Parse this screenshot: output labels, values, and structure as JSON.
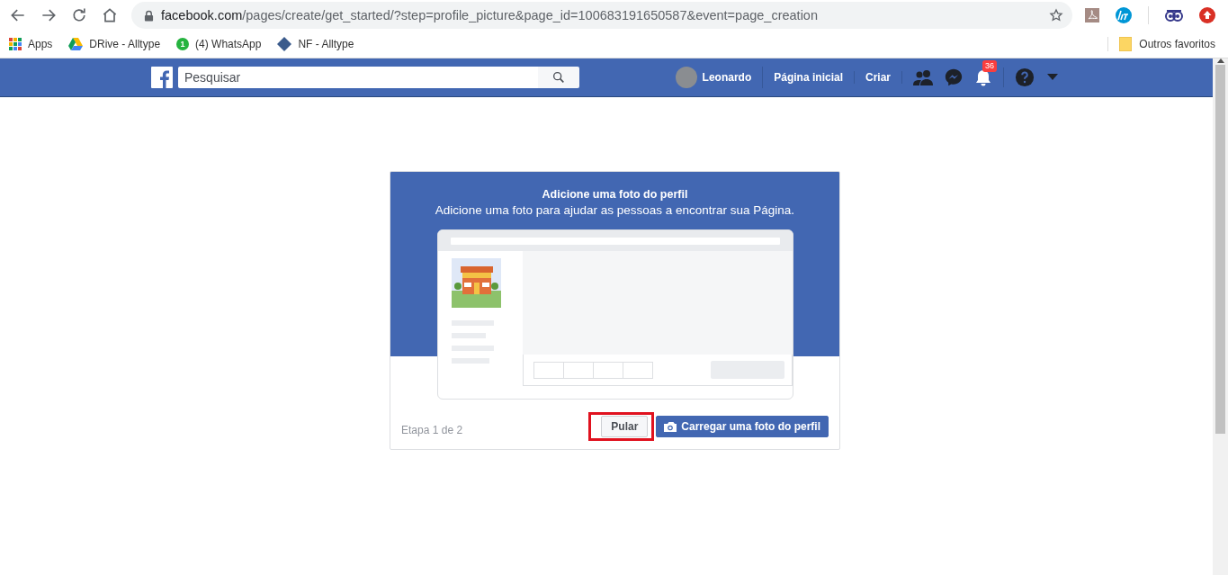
{
  "browser": {
    "url_host": "facebook.com",
    "url_path": "/pages/create/get_started/?step=profile_picture&page_id=100683191650587&event=page_creation"
  },
  "bookmarks": [
    {
      "kind": "apps",
      "label": "Apps"
    },
    {
      "kind": "drive",
      "label": "DRive - Alltype"
    },
    {
      "kind": "whatsapp",
      "label": "(4) WhatsApp",
      "badge": "1"
    },
    {
      "kind": "nf",
      "label": "NF - Alltype"
    }
  ],
  "other_bookmarks": "Outros favoritos",
  "facebook_header": {
    "search": {
      "placeholder": "Pesquisar"
    },
    "profile_name": "Leonardo",
    "nav_links": [
      "Página inicial",
      "Criar"
    ],
    "notification_count": "36"
  },
  "dialog": {
    "title": "Adicione uma foto do perfil",
    "subtitle": "Adicione uma foto para ajudar as pessoas a encontrar sua Página.",
    "step": "Etapa 1 de 2",
    "buttons": [
      {
        "kind": "skip",
        "label": "Pular",
        "highlighted": true
      },
      {
        "kind": "upload",
        "label": "Carregar uma foto do perfil",
        "highlighted": false
      }
    ]
  }
}
